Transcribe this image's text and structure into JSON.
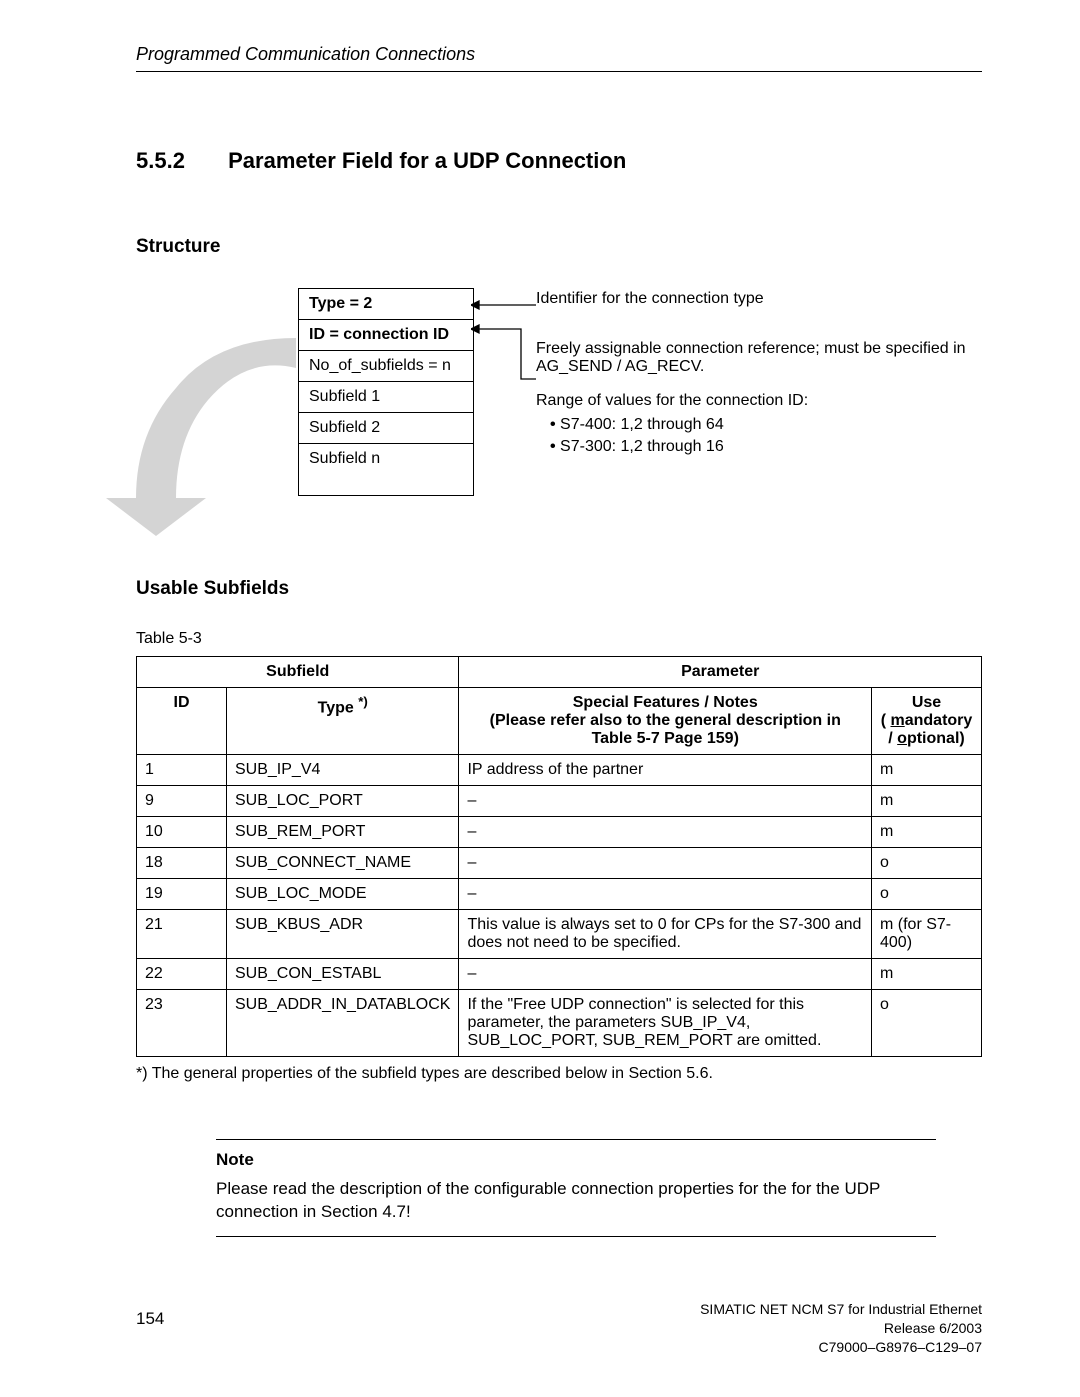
{
  "header": {
    "running_title": "Programmed Communication Connections"
  },
  "section": {
    "number": "5.5.2",
    "title": "Parameter Field for a UDP Connection"
  },
  "structure": {
    "heading": "Structure",
    "cells": {
      "type": "Type = 2",
      "id": "ID = connection ID",
      "no_subfields": "No_of_subfields = n",
      "subfield1": "Subfield 1",
      "subfield2": "Subfield 2",
      "subfieldn": "Subfield n"
    },
    "callouts": {
      "type_id": "Identifier for the connection type",
      "conn_ref": "Freely assignable connection reference; must be specified in AG_SEND / AG_RECV.",
      "range_label": "Range of values for the connection ID:",
      "range_items": [
        "S7-400: 1,2 through 64",
        "S7-300: 1,2 through 16"
      ]
    }
  },
  "usable": {
    "heading": "Usable Subfields",
    "caption": "Table 5-3",
    "headers": {
      "subfield": "Subfield",
      "parameter": "Parameter",
      "id": "ID",
      "type": "Type ",
      "type_sup": "*)",
      "notes": "Special Features / Notes\n(Please refer also to the general description in Table 5-7 Page 159)",
      "use": "Use",
      "use_m": "( mandatory",
      "use_o": "/ optional)"
    },
    "rows": [
      {
        "id": "1",
        "type": "SUB_IP_V4",
        "notes": "IP address of the partner",
        "use": "m"
      },
      {
        "id": "9",
        "type": "SUB_LOC_PORT",
        "notes": "–",
        "use": "m"
      },
      {
        "id": "10",
        "type": "SUB_REM_PORT",
        "notes": "–",
        "use": "m"
      },
      {
        "id": "18",
        "type": "SUB_CONNECT_NAME",
        "notes": "–",
        "use": "o"
      },
      {
        "id": "19",
        "type": "SUB_LOC_MODE",
        "notes": "–",
        "use": "o"
      },
      {
        "id": "21",
        "type": "SUB_KBUS_ADR",
        "notes": "This value is always set to 0 for CPs for the S7-300 and does not need to be specified.",
        "use": "m (for S7-400)"
      },
      {
        "id": "22",
        "type": "SUB_CON_ESTABL",
        "notes": "–",
        "use": "m"
      },
      {
        "id": "23",
        "type": "SUB_ADDR_IN_DATABLOCK",
        "notes": "If the \"Free UDP connection\" is selected for this parameter, the parameters SUB_IP_V4, SUB_LOC_PORT, SUB_REM_PORT are omitted.",
        "use": "o"
      }
    ],
    "footnote": "*) The general properties of the subfield types are described below in Section 5.6."
  },
  "note": {
    "title": "Note",
    "text": "Please read the description of the configurable connection properties for the for the UDP connection in Section 4.7!"
  },
  "footer": {
    "page": "154",
    "line1": "SIMATIC NET NCM S7 for Industrial Ethernet",
    "line2": "Release 6/2003",
    "line3": "C79000–G8976–C129–07"
  }
}
